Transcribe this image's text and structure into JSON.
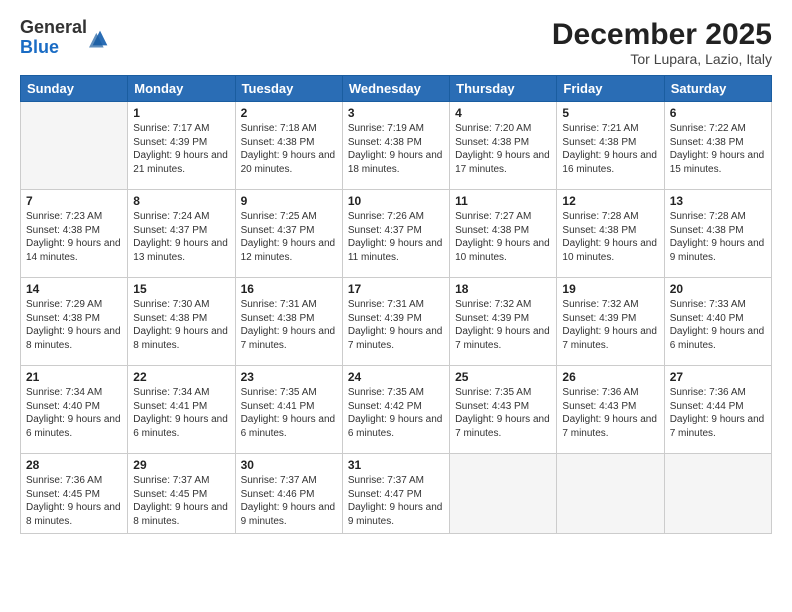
{
  "logo": {
    "text_general": "General",
    "text_blue": "Blue"
  },
  "header": {
    "month_title": "December 2025",
    "location": "Tor Lupara, Lazio, Italy"
  },
  "weekdays": [
    "Sunday",
    "Monday",
    "Tuesday",
    "Wednesday",
    "Thursday",
    "Friday",
    "Saturday"
  ],
  "weeks": [
    [
      {
        "day": "",
        "empty": true
      },
      {
        "day": "1",
        "sunrise": "7:17 AM",
        "sunset": "4:39 PM",
        "daylight": "9 hours and 21 minutes."
      },
      {
        "day": "2",
        "sunrise": "7:18 AM",
        "sunset": "4:38 PM",
        "daylight": "9 hours and 20 minutes."
      },
      {
        "day": "3",
        "sunrise": "7:19 AM",
        "sunset": "4:38 PM",
        "daylight": "9 hours and 18 minutes."
      },
      {
        "day": "4",
        "sunrise": "7:20 AM",
        "sunset": "4:38 PM",
        "daylight": "9 hours and 17 minutes."
      },
      {
        "day": "5",
        "sunrise": "7:21 AM",
        "sunset": "4:38 PM",
        "daylight": "9 hours and 16 minutes."
      },
      {
        "day": "6",
        "sunrise": "7:22 AM",
        "sunset": "4:38 PM",
        "daylight": "9 hours and 15 minutes."
      }
    ],
    [
      {
        "day": "7",
        "sunrise": "7:23 AM",
        "sunset": "4:38 PM",
        "daylight": "9 hours and 14 minutes."
      },
      {
        "day": "8",
        "sunrise": "7:24 AM",
        "sunset": "4:37 PM",
        "daylight": "9 hours and 13 minutes."
      },
      {
        "day": "9",
        "sunrise": "7:25 AM",
        "sunset": "4:37 PM",
        "daylight": "9 hours and 12 minutes."
      },
      {
        "day": "10",
        "sunrise": "7:26 AM",
        "sunset": "4:37 PM",
        "daylight": "9 hours and 11 minutes."
      },
      {
        "day": "11",
        "sunrise": "7:27 AM",
        "sunset": "4:38 PM",
        "daylight": "9 hours and 10 minutes."
      },
      {
        "day": "12",
        "sunrise": "7:28 AM",
        "sunset": "4:38 PM",
        "daylight": "9 hours and 10 minutes."
      },
      {
        "day": "13",
        "sunrise": "7:28 AM",
        "sunset": "4:38 PM",
        "daylight": "9 hours and 9 minutes."
      }
    ],
    [
      {
        "day": "14",
        "sunrise": "7:29 AM",
        "sunset": "4:38 PM",
        "daylight": "9 hours and 8 minutes."
      },
      {
        "day": "15",
        "sunrise": "7:30 AM",
        "sunset": "4:38 PM",
        "daylight": "9 hours and 8 minutes."
      },
      {
        "day": "16",
        "sunrise": "7:31 AM",
        "sunset": "4:38 PM",
        "daylight": "9 hours and 7 minutes."
      },
      {
        "day": "17",
        "sunrise": "7:31 AM",
        "sunset": "4:39 PM",
        "daylight": "9 hours and 7 minutes."
      },
      {
        "day": "18",
        "sunrise": "7:32 AM",
        "sunset": "4:39 PM",
        "daylight": "9 hours and 7 minutes."
      },
      {
        "day": "19",
        "sunrise": "7:32 AM",
        "sunset": "4:39 PM",
        "daylight": "9 hours and 7 minutes."
      },
      {
        "day": "20",
        "sunrise": "7:33 AM",
        "sunset": "4:40 PM",
        "daylight": "9 hours and 6 minutes."
      }
    ],
    [
      {
        "day": "21",
        "sunrise": "7:34 AM",
        "sunset": "4:40 PM",
        "daylight": "9 hours and 6 minutes."
      },
      {
        "day": "22",
        "sunrise": "7:34 AM",
        "sunset": "4:41 PM",
        "daylight": "9 hours and 6 minutes."
      },
      {
        "day": "23",
        "sunrise": "7:35 AM",
        "sunset": "4:41 PM",
        "daylight": "9 hours and 6 minutes."
      },
      {
        "day": "24",
        "sunrise": "7:35 AM",
        "sunset": "4:42 PM",
        "daylight": "9 hours and 6 minutes."
      },
      {
        "day": "25",
        "sunrise": "7:35 AM",
        "sunset": "4:43 PM",
        "daylight": "9 hours and 7 minutes."
      },
      {
        "day": "26",
        "sunrise": "7:36 AM",
        "sunset": "4:43 PM",
        "daylight": "9 hours and 7 minutes."
      },
      {
        "day": "27",
        "sunrise": "7:36 AM",
        "sunset": "4:44 PM",
        "daylight": "9 hours and 7 minutes."
      }
    ],
    [
      {
        "day": "28",
        "sunrise": "7:36 AM",
        "sunset": "4:45 PM",
        "daylight": "9 hours and 8 minutes."
      },
      {
        "day": "29",
        "sunrise": "7:37 AM",
        "sunset": "4:45 PM",
        "daylight": "9 hours and 8 minutes."
      },
      {
        "day": "30",
        "sunrise": "7:37 AM",
        "sunset": "4:46 PM",
        "daylight": "9 hours and 9 minutes."
      },
      {
        "day": "31",
        "sunrise": "7:37 AM",
        "sunset": "4:47 PM",
        "daylight": "9 hours and 9 minutes."
      },
      {
        "day": "",
        "empty": true
      },
      {
        "day": "",
        "empty": true
      },
      {
        "day": "",
        "empty": true
      }
    ]
  ]
}
